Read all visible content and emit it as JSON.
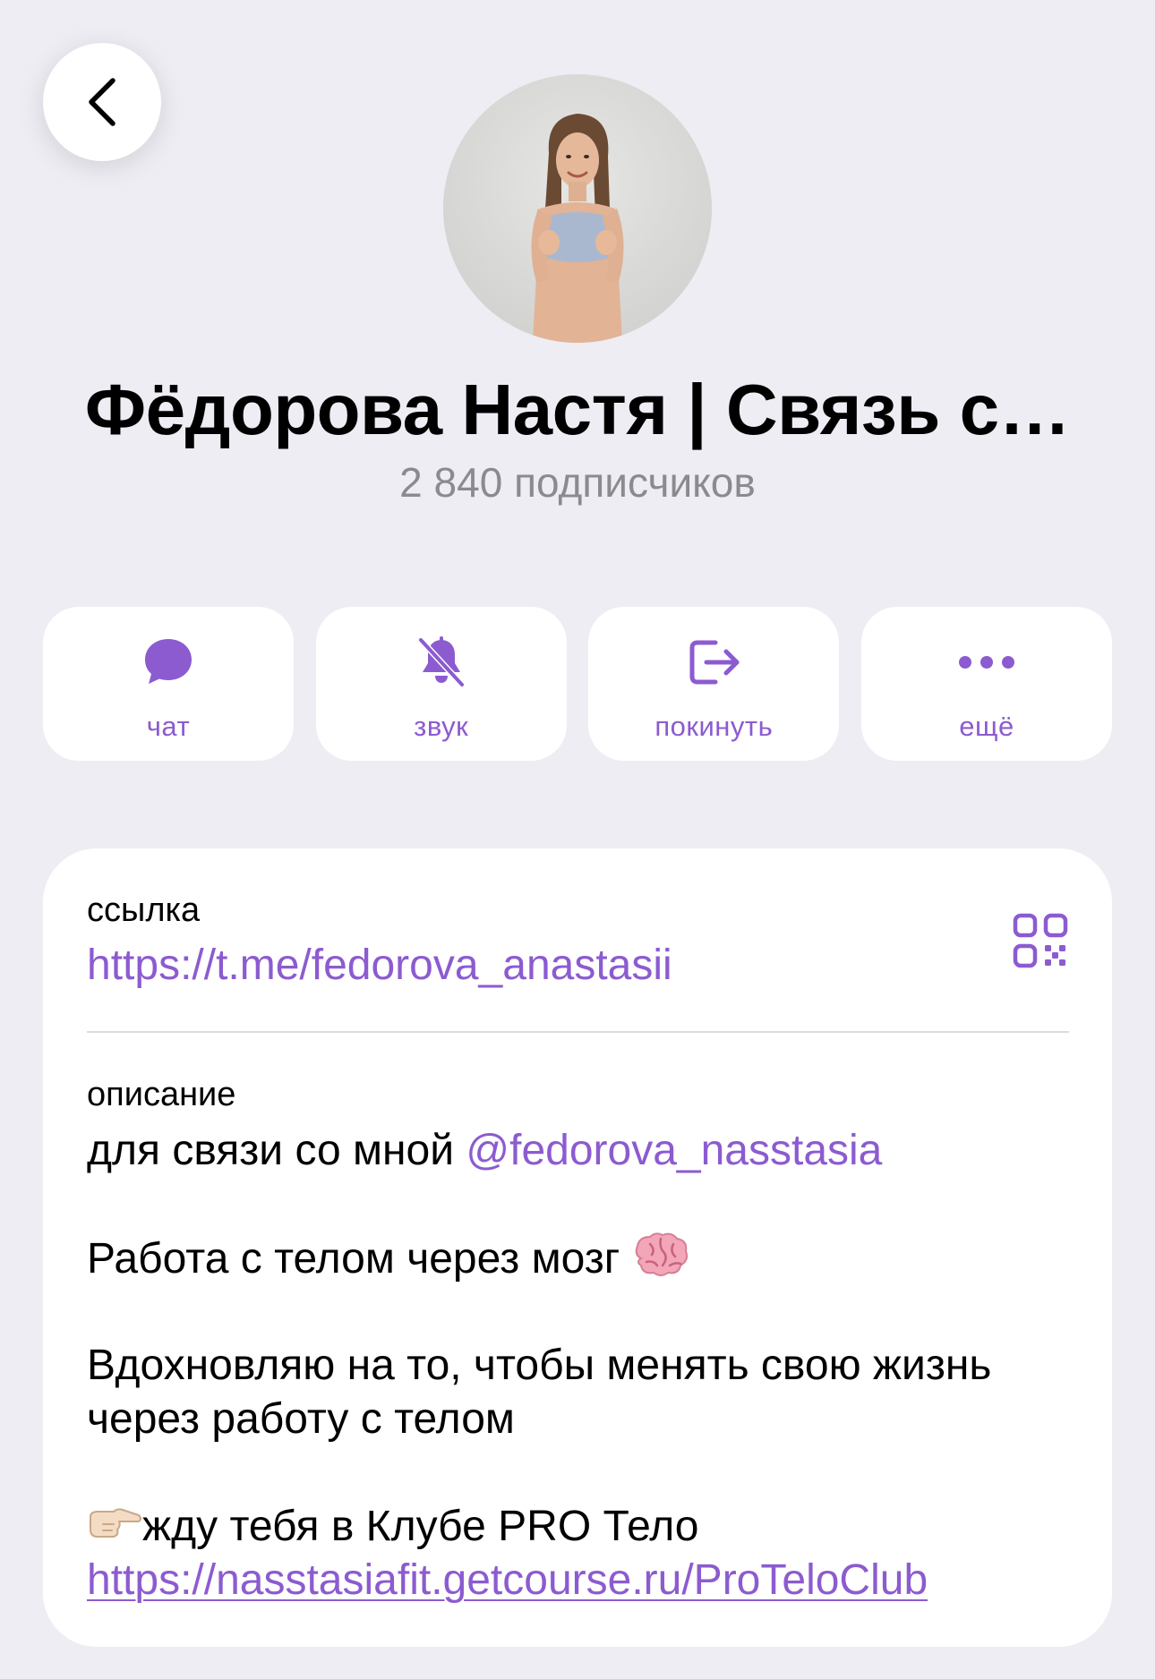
{
  "header": {
    "back_icon": "chevron-left-icon",
    "title": "Фёдорова Настя | Связь с…",
    "subscribers": "2 840 подписчиков"
  },
  "actions": [
    {
      "label": "чат",
      "icon": "chat-bubble-icon"
    },
    {
      "label": "звук",
      "icon": "bell-muted-icon"
    },
    {
      "label": "покинуть",
      "icon": "leave-icon"
    },
    {
      "label": "ещё",
      "icon": "more-dots-icon"
    }
  ],
  "info": {
    "link_label": "ссылка",
    "link_value": "https://t.me/fedorova_anastasii",
    "qr_icon": "qr-code-icon",
    "description_label": "описание",
    "description": {
      "line1_text": "для связи со мной ",
      "line1_mention": "@fedorova_nasstasia",
      "line2_text": "Работа с телом через мозг",
      "line2_emoji": "brain-icon",
      "line3": "Вдохновляю на то, чтобы менять свою жизнь",
      "line4": "через работу с телом",
      "line5_emoji": "pointing-right-icon",
      "line5_text": "жду тебя в Клубе PRO Тело",
      "line6_url": "https://nasstasiafit.getcourse.ru/ProTeloClub"
    }
  },
  "colors": {
    "accent": "#8c5bd0",
    "background": "#eeedf3",
    "card": "#ffffff",
    "secondary_text": "#8a8a8f"
  }
}
